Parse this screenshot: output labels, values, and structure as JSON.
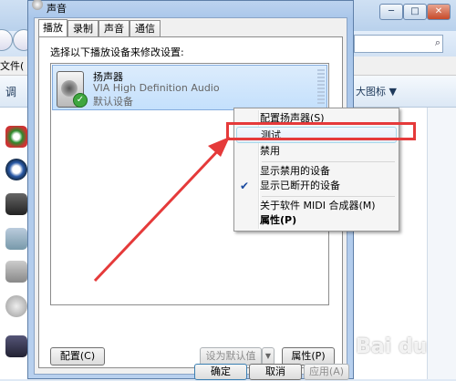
{
  "dialog": {
    "title": "声音",
    "tabs": [
      {
        "label": "播放",
        "active": true
      },
      {
        "label": "录制",
        "active": false
      },
      {
        "label": "声音",
        "active": false
      },
      {
        "label": "通信",
        "active": false
      }
    ],
    "instruction": "选择以下播放设备来修改设置:",
    "device": {
      "name": "扬声器",
      "driver": "VIA High Definition Audio",
      "status": "默认设备"
    },
    "buttons": {
      "configure": "配置(C)",
      "set_default": "设为默认值(S)",
      "properties": "属性(P)",
      "ok": "确定",
      "cancel": "取消",
      "apply": "应用(A)"
    }
  },
  "context_menu": {
    "items": [
      {
        "label": "配置扬声器(S)",
        "highlighted": false,
        "checked": false,
        "bold": false
      },
      {
        "label": "测试",
        "highlighted": true,
        "checked": false,
        "bold": false
      },
      {
        "label": "禁用",
        "highlighted": false,
        "checked": false,
        "bold": false
      },
      {
        "label": "显示禁用的设备",
        "highlighted": false,
        "checked": false,
        "bold": false
      },
      {
        "label": "显示已断开的设备",
        "highlighted": false,
        "checked": true,
        "bold": false
      },
      {
        "label": "关于软件 MIDI 合成器(M)",
        "highlighted": false,
        "checked": false,
        "bold": false
      },
      {
        "label": "属性(P)",
        "highlighted": false,
        "checked": false,
        "bold": true
      }
    ]
  },
  "background_window": {
    "menu_fragment": "文件(",
    "cmd_left": "调",
    "cmd_right": "大图标 ▼"
  },
  "watermark": "Bai du",
  "colors": {
    "annotation_red": "#e53a3a",
    "selection_blue": "#c4e0fc",
    "check_green": "#3fa63f"
  }
}
